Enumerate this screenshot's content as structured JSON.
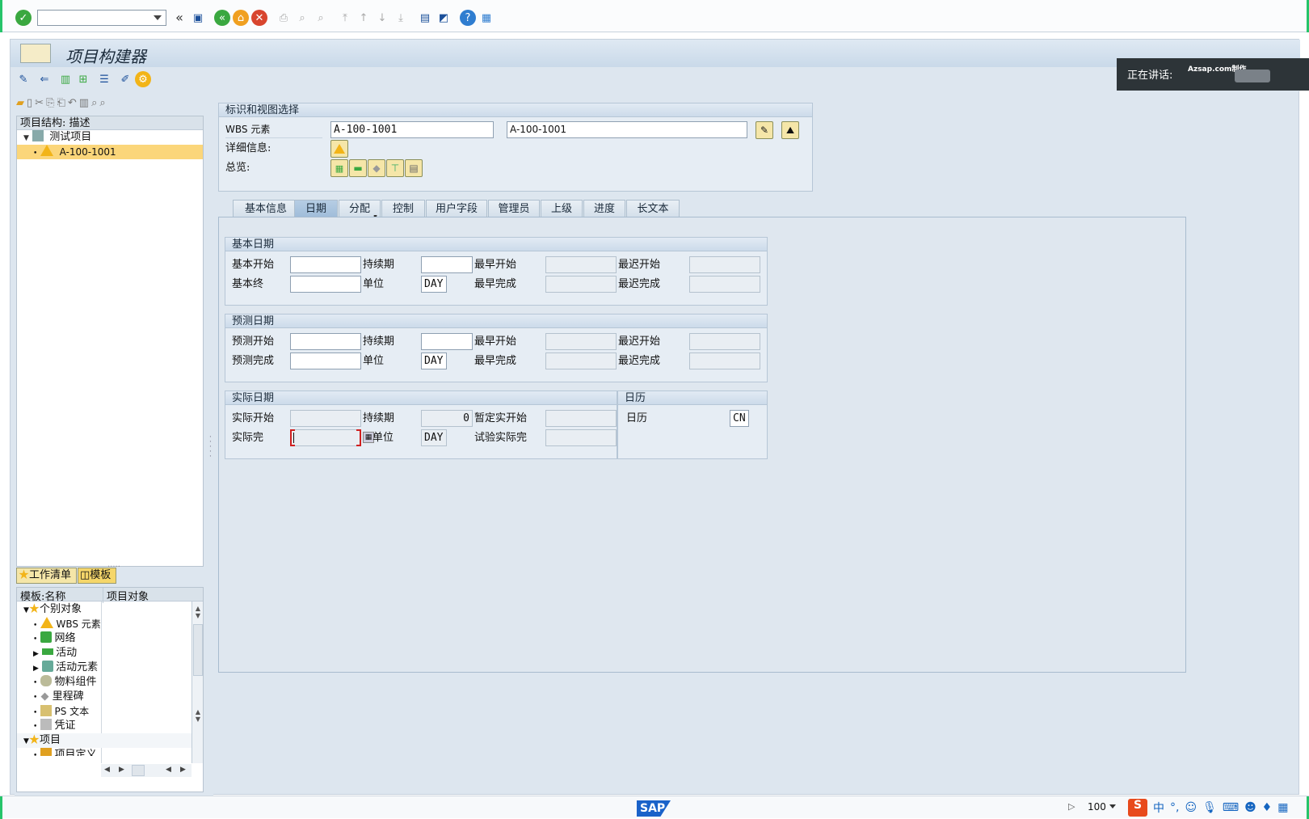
{
  "toolbar": {
    "command_value": "",
    "zoom": "100"
  },
  "window": {
    "title": "项目构建器"
  },
  "overlay": {
    "speaking_label": "正在讲话:",
    "watermark": "Azsap.com制作"
  },
  "tree": {
    "header": "项目结构: 描述",
    "items": [
      {
        "label": "测试项目"
      },
      {
        "label": "A-100-1001"
      }
    ]
  },
  "lower_tabs": {
    "worklist": "工作清单",
    "templates": "模板"
  },
  "template_tree": {
    "col1": "模板:名称",
    "col2": "项目对象",
    "items": [
      {
        "label": "个别对象"
      },
      {
        "label": "WBS 元素"
      },
      {
        "label": "网络"
      },
      {
        "label": "活动"
      },
      {
        "label": "活动元素"
      },
      {
        "label": "物料组件"
      },
      {
        "label": "里程碑"
      },
      {
        "label": "PS 文本"
      },
      {
        "label": "凭证"
      },
      {
        "label": "项目"
      },
      {
        "label": "项目定义"
      }
    ]
  },
  "ident": {
    "header": "标识和视图选择",
    "wbs_label": "WBS 元素",
    "wbs_value": "A-100-1001",
    "wbs_desc": "A-100-1001",
    "detail_label": "详细信息:",
    "overview_label": "总览:"
  },
  "tabs": [
    "基本信息",
    "日期",
    "分配",
    "控制",
    "用户字段",
    "管理员",
    "上级",
    "进度",
    "长文本"
  ],
  "basic_dates": {
    "header": "基本日期",
    "start_label": "基本开始",
    "end_label": "基本终",
    "duration_label": "持续期",
    "unit_label": "单位",
    "unit_value": "DAY",
    "earliest_start": "最早开始",
    "latest_start": "最迟开始",
    "earliest_finish": "最早完成",
    "latest_finish": "最迟完成"
  },
  "forecast_dates": {
    "header": "预测日期",
    "start_label": "预测开始",
    "end_label": "预测完成",
    "duration_label": "持续期",
    "unit_label": "单位",
    "unit_value": "DAY",
    "earliest_start": "最早开始",
    "latest_start": "最迟开始",
    "earliest_finish": "最早完成",
    "latest_finish": "最迟完成"
  },
  "actual_dates": {
    "header": "实际日期",
    "start_label": "实际开始",
    "end_label": "实际完",
    "duration_label": "持续期",
    "duration_value": "0",
    "unit_label": "单位",
    "unit_value": "DAY",
    "tentative_start": "暂定实开始",
    "tentative_finish": "试验实际完"
  },
  "calendar": {
    "header": "日历",
    "label": "日历",
    "value": "CN"
  },
  "colors": {
    "accent": "#f2b418",
    "selection": "#fbd67a",
    "frame": "#dde6ef"
  }
}
